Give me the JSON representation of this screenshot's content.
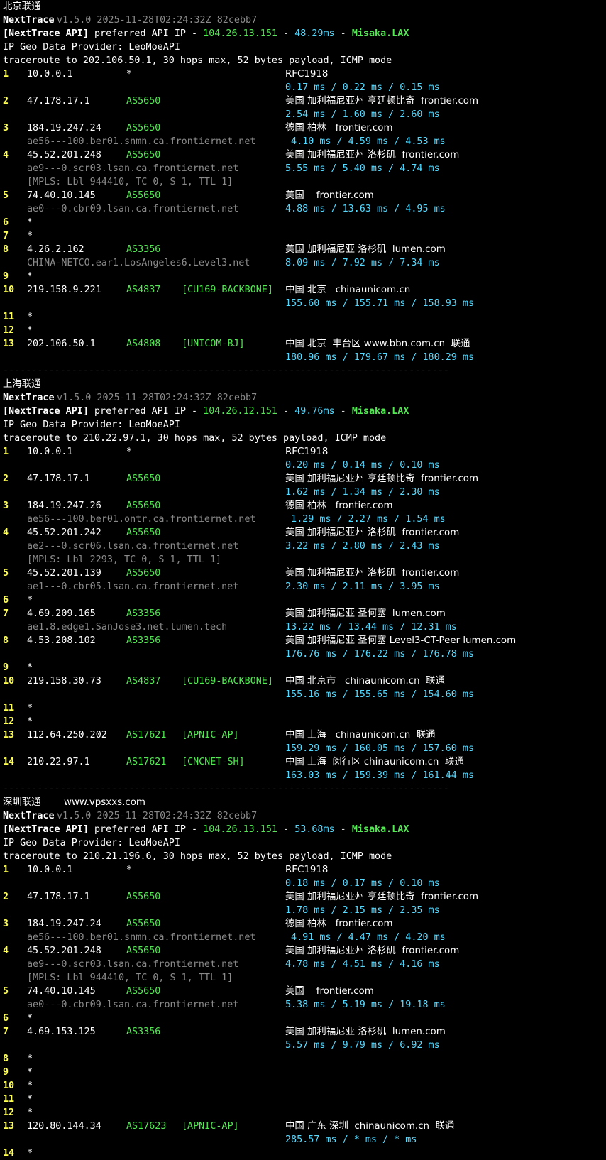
{
  "blocks": [
    {
      "label": "北京联通",
      "site": "",
      "header": {
        "app": "NextTrace",
        "version": "v1.5.0 2025-11-28T02:24:32Z 82cebb7",
        "api_label": "[NextTrace API]",
        "api_text": "preferred API IP -",
        "api_ip": "104.26.13.151",
        "api_ms": "48.29ms",
        "api_site": "Misaka.LAX",
        "geo_provider": "IP Geo Data Provider: LeoMoeAPI",
        "traceroute": "traceroute to 202.106.50.1, 30 hops max, 52 bytes payload, ICMP mode"
      },
      "hops": [
        {
          "n": "1",
          "ip": "10.0.0.1",
          "as": "*",
          "tag": "",
          "geo": "RFC1918",
          "rtt": "0.17 ms / 0.22 ms / 0.15 ms"
        },
        {
          "n": "2",
          "ip": "47.178.17.1",
          "as": "AS5650",
          "tag": "",
          "geo": "美国 加利福尼亚州 亨廷顿比奇  frontier.com",
          "rtt": "2.54 ms / 1.60 ms / 2.60 ms"
        },
        {
          "n": "3",
          "ip": "184.19.247.24",
          "as": "AS5650",
          "tag": "",
          "geo": "德国 柏林   frontier.com",
          "host": "ae56---100.ber01.snmn.ca.frontiernet.net",
          "rtt": " 4.10 ms / 4.59 ms / 4.53 ms"
        },
        {
          "n": "4",
          "ip": "45.52.201.248",
          "as": "AS5650",
          "tag": "",
          "geo": "美国 加利福尼亚州 洛杉矶  frontier.com",
          "host": "ae9---0.scr03.lsan.ca.frontiernet.net",
          "rtt": "5.55 ms / 5.40 ms / 4.74 ms",
          "mpls": "[MPLS: Lbl 944410, TC 0, S 1, TTL 1]"
        },
        {
          "n": "5",
          "ip": "74.40.10.145",
          "as": "AS5650",
          "tag": "",
          "geo": "美国    frontier.com",
          "host": "ae0---0.cbr09.lsan.ca.frontiernet.net",
          "rtt": "4.88 ms / 13.63 ms / 4.95 ms"
        },
        {
          "n": "6",
          "star": "*"
        },
        {
          "n": "7",
          "star": "*"
        },
        {
          "n": "8",
          "ip": "4.26.2.162",
          "as": "AS3356",
          "tag": "",
          "geo": "美国 加利福尼亚 洛杉矶  lumen.com",
          "host": "CHINA-NETCO.ear1.LosAngeles6.Level3.net",
          "rtt": "8.09 ms / 7.92 ms / 7.34 ms"
        },
        {
          "n": "9",
          "star": "*"
        },
        {
          "n": "10",
          "ip": "219.158.9.221",
          "as": "AS4837",
          "tag": "[CU169-BACKBONE]",
          "geo": "中国 北京   chinaunicom.cn",
          "rtt": "155.60 ms / 155.71 ms / 158.93 ms"
        },
        {
          "n": "11",
          "star": "*"
        },
        {
          "n": "12",
          "star": "*"
        },
        {
          "n": "13",
          "ip": "202.106.50.1",
          "as": "AS4808",
          "tag": "[UNICOM-BJ]",
          "geo": "中国 北京  丰台区 www.bbn.com.cn  联通",
          "rtt": "180.96 ms / 179.67 ms / 180.29 ms"
        }
      ]
    },
    {
      "label": "上海联通",
      "site": "",
      "header": {
        "app": "NextTrace",
        "version": "v1.5.0 2025-11-28T02:24:32Z 82cebb7",
        "api_label": "[NextTrace API]",
        "api_text": "preferred API IP -",
        "api_ip": "104.26.12.151",
        "api_ms": "49.76ms",
        "api_site": "Misaka.LAX",
        "geo_provider": "IP Geo Data Provider: LeoMoeAPI",
        "traceroute": "traceroute to 210.22.97.1, 30 hops max, 52 bytes payload, ICMP mode"
      },
      "hops": [
        {
          "n": "1",
          "ip": "10.0.0.1",
          "as": "*",
          "tag": "",
          "geo": "RFC1918",
          "rtt": "0.20 ms / 0.14 ms / 0.10 ms"
        },
        {
          "n": "2",
          "ip": "47.178.17.1",
          "as": "AS5650",
          "tag": "",
          "geo": "美国 加利福尼亚州 亨廷顿比奇  frontier.com",
          "rtt": "1.62 ms / 1.34 ms / 2.30 ms"
        },
        {
          "n": "3",
          "ip": "184.19.247.26",
          "as": "AS5650",
          "tag": "",
          "geo": "德国 柏林   frontier.com",
          "host": "ae56---100.ber01.ontr.ca.frontiernet.net",
          "rtt": " 1.29 ms / 2.27 ms / 1.54 ms"
        },
        {
          "n": "4",
          "ip": "45.52.201.242",
          "as": "AS5650",
          "tag": "",
          "geo": "美国 加利福尼亚州 洛杉矶  frontier.com",
          "host": "ae2---0.scr06.lsan.ca.frontiernet.net",
          "rtt": "3.22 ms / 2.80 ms / 2.43 ms",
          "mpls": "[MPLS: Lbl 2293, TC 0, S 1, TTL 1]"
        },
        {
          "n": "5",
          "ip": "45.52.201.139",
          "as": "AS5650",
          "tag": "",
          "geo": "美国 加利福尼亚州 洛杉矶  frontier.com",
          "host": "ae1---0.cbr05.lsan.ca.frontiernet.net",
          "rtt": "2.30 ms / 2.11 ms / 3.95 ms"
        },
        {
          "n": "6",
          "star": "*"
        },
        {
          "n": "7",
          "ip": "4.69.209.165",
          "as": "AS3356",
          "tag": "",
          "geo": "美国 加利福尼亚 圣何塞  lumen.com",
          "host": "ae1.8.edge1.SanJose3.net.lumen.tech",
          "rtt": "13.22 ms / 13.44 ms / 12.31 ms"
        },
        {
          "n": "8",
          "ip": "4.53.208.102",
          "as": "AS3356",
          "tag": "",
          "geo": "美国 加利福尼亚 圣何塞 Level3-CT-Peer lumen.com",
          "rtt": "176.76 ms / 176.22 ms / 176.78 ms"
        },
        {
          "n": "9",
          "star": "*"
        },
        {
          "n": "10",
          "ip": "219.158.30.73",
          "as": "AS4837",
          "tag": "[CU169-BACKBONE]",
          "geo": "中国 北京市   chinaunicom.cn  联通",
          "rtt": "155.16 ms / 155.65 ms / 154.60 ms"
        },
        {
          "n": "11",
          "star": "*"
        },
        {
          "n": "12",
          "star": "*"
        },
        {
          "n": "13",
          "ip": "112.64.250.202",
          "as": "AS17621",
          "tag": "[APNIC-AP]",
          "geo": "中国 上海   chinaunicom.cn  联通",
          "rtt": "159.29 ms / 160.05 ms / 157.60 ms"
        },
        {
          "n": "14",
          "ip": "210.22.97.1",
          "as": "AS17621",
          "tag": "[CNCNET-SH]",
          "geo": "中国 上海  闵行区 chinaunicom.cn  联通",
          "rtt": "163.03 ms / 159.39 ms / 161.44 ms"
        }
      ]
    },
    {
      "label": "深圳联通",
      "site": "www.vpsxxs.com",
      "header": {
        "app": "NextTrace",
        "version": "v1.5.0 2025-11-28T02:24:32Z 82cebb7",
        "api_label": "[NextTrace API]",
        "api_text": "preferred API IP -",
        "api_ip": "104.26.13.151",
        "api_ms": "53.68ms",
        "api_site": "Misaka.LAX",
        "geo_provider": "IP Geo Data Provider: LeoMoeAPI",
        "traceroute": "traceroute to 210.21.196.6, 30 hops max, 52 bytes payload, ICMP mode"
      },
      "hops": [
        {
          "n": "1",
          "ip": "10.0.0.1",
          "as": "*",
          "tag": "",
          "geo": "RFC1918",
          "rtt": "0.18 ms / 0.17 ms / 0.10 ms"
        },
        {
          "n": "2",
          "ip": "47.178.17.1",
          "as": "AS5650",
          "tag": "",
          "geo": "美国 加利福尼亚州 亨廷顿比奇  frontier.com",
          "rtt": "1.78 ms / 2.15 ms / 2.35 ms"
        },
        {
          "n": "3",
          "ip": "184.19.247.24",
          "as": "AS5650",
          "tag": "",
          "geo": "德国 柏林   frontier.com",
          "host": "ae56---100.ber01.snmn.ca.frontiernet.net",
          "rtt": " 4.91 ms / 4.47 ms / 4.20 ms"
        },
        {
          "n": "4",
          "ip": "45.52.201.248",
          "as": "AS5650",
          "tag": "",
          "geo": "美国 加利福尼亚州 洛杉矶  frontier.com",
          "host": "ae9---0.scr03.lsan.ca.frontiernet.net",
          "rtt": "4.78 ms / 4.51 ms / 4.16 ms",
          "mpls": "[MPLS: Lbl 944410, TC 0, S 1, TTL 1]"
        },
        {
          "n": "5",
          "ip": "74.40.10.145",
          "as": "AS5650",
          "tag": "",
          "geo": "美国    frontier.com",
          "host": "ae0---0.cbr09.lsan.ca.frontiernet.net",
          "rtt": "5.38 ms / 5.19 ms / 19.18 ms"
        },
        {
          "n": "6",
          "star": "*"
        },
        {
          "n": "7",
          "ip": "4.69.153.125",
          "as": "AS3356",
          "tag": "",
          "geo": "美国 加利福尼亚 洛杉矶  lumen.com",
          "rtt": "5.57 ms / 9.79 ms / 6.92 ms"
        },
        {
          "n": "8",
          "star": "*"
        },
        {
          "n": "9",
          "star": "*"
        },
        {
          "n": "10",
          "star": "*"
        },
        {
          "n": "11",
          "star": "*"
        },
        {
          "n": "12",
          "star": "*"
        },
        {
          "n": "13",
          "ip": "120.80.144.34",
          "as": "AS17623",
          "tag": "[APNIC-AP]",
          "geo": "中国 广东 深圳  chinaunicom.cn  联通",
          "rtt": "285.57 ms / * ms / * ms"
        },
        {
          "n": "14",
          "star": "*"
        }
      ]
    }
  ],
  "separator": "------------------------------------------------------------------------------"
}
